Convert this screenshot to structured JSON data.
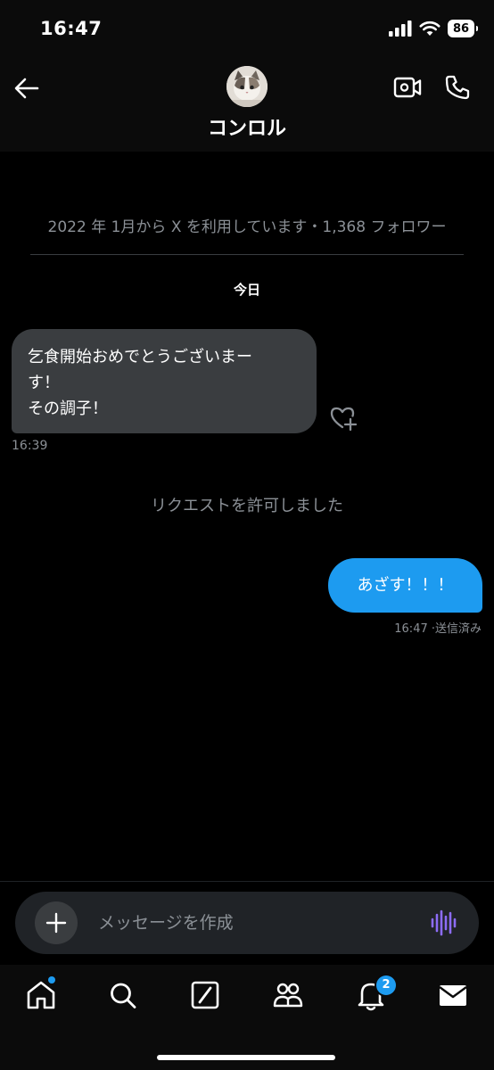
{
  "status_bar": {
    "time": "16:47",
    "battery": "86",
    "icons": [
      "cellular-signal-icon",
      "wifi-icon",
      "battery-icon"
    ]
  },
  "header": {
    "title": "コンロル",
    "back_icon": "arrow-left-icon",
    "actions": [
      "video-call-icon",
      "phone-call-icon"
    ]
  },
  "conversation": {
    "profile_meta": "2022 年 1月から X を利用しています・1,368 フォロワー",
    "day_label": "今日",
    "messages": [
      {
        "direction": "incoming",
        "lines": [
          "乞食開始おめでとうございまー",
          "す！",
          "その調子！"
        ],
        "time": "16:39"
      },
      {
        "direction": "system",
        "text": "リクエストを許可しました"
      },
      {
        "direction": "outgoing",
        "text": "あざす！！！",
        "time_status": "16:47 ·送信済み"
      }
    ]
  },
  "composer": {
    "placeholder": "メッセージを作成",
    "plus_icon": "plus-icon",
    "voice_icon": "voice-waveform-icon"
  },
  "tab_bar": {
    "tabs": [
      "home-icon",
      "search-icon",
      "grok-icon",
      "communities-icon",
      "notifications-icon",
      "messages-icon"
    ],
    "notifications_badge": "2"
  },
  "colors": {
    "accent": "#1d9bf0",
    "incoming_bubble": "#3a3d40",
    "muted_text": "#8b9096",
    "voice_icon": "#8c6cf6"
  }
}
